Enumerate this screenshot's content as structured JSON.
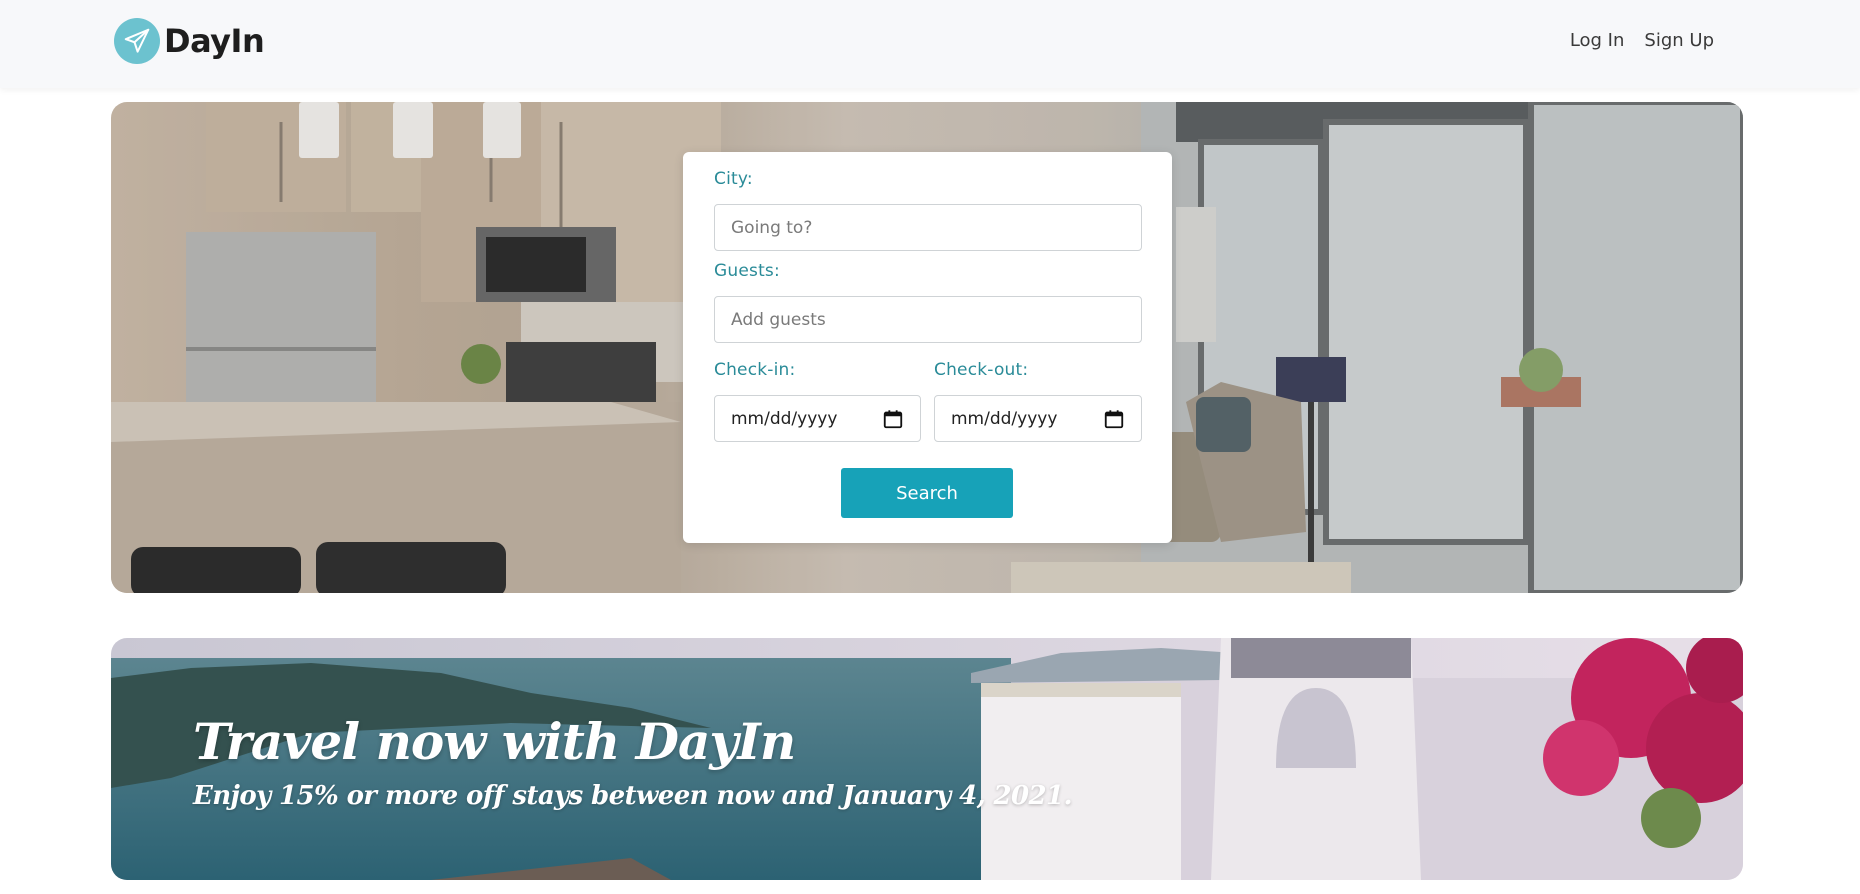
{
  "brand": {
    "name": "DayIn",
    "logo_icon": "paper-plane-icon",
    "logo_color": "#6cc2cf"
  },
  "nav": {
    "login_label": "Log In",
    "signup_label": "Sign Up"
  },
  "search_form": {
    "city_label": "City:",
    "city_placeholder": "Going to?",
    "guests_label": "Guests:",
    "guests_placeholder": "Add guests",
    "checkin_label": "Check-in:",
    "checkin_value": "mm/dd/yyyy",
    "checkout_label": "Check-out:",
    "checkout_value": "mm/dd/yyyy",
    "calendar_icon": "calendar-icon",
    "search_label": "Search",
    "accent_color": "#17a2b8",
    "label_color": "#2a8b98"
  },
  "promo": {
    "title": "Travel now with DayIn",
    "subtitle": "Enjoy 15% or more off stays between now and January 4, 2021."
  }
}
